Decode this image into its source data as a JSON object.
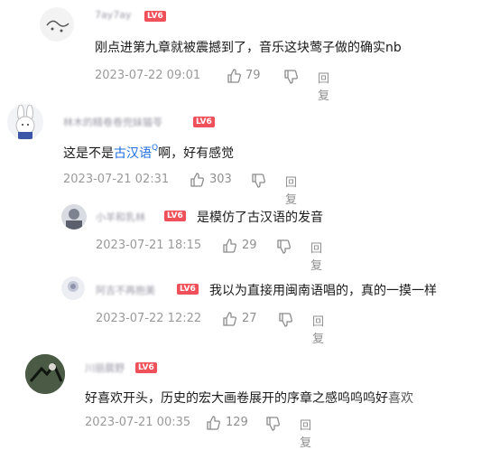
{
  "comments": [
    {
      "username": "7ay7ay",
      "level": "LV6",
      "text": "刚点进第九章就被震撼到了，音乐这块莺子做的确实nb",
      "date": "2023-07-22 09:01",
      "likes": "79",
      "reply_label": "回复"
    },
    {
      "username": "林木的精卷卷兜妹猫苓",
      "level": "LV6",
      "text_before": "这是不是",
      "link_text": "古汉语",
      "link_mark": "Q",
      "text_after": "啊，好有感觉",
      "date": "2023-07-21 02:31",
      "likes": "303",
      "reply_label": "回复"
    },
    {
      "username": "小羊和乳林",
      "level": "LV6",
      "text": "是模仿了古汉语的发音",
      "date": "2023-07-21 18:15",
      "likes": "29",
      "reply_label": "回复"
    },
    {
      "username": "阿吉不再抱美",
      "level": "LV6",
      "text": "我以为直接用闽南语唱的，真的一摸一样",
      "date": "2023-07-22 12:22",
      "likes": "27",
      "reply_label": "回复"
    },
    {
      "username": "川丽晨野",
      "level": "LV6",
      "text": "好喜欢开头，历史的宏大画卷展开的序章之感呜呜呜好",
      "text_tail": "喜欢",
      "date": "2023-07-21 00:35",
      "likes": "129",
      "reply_label": "回复"
    }
  ]
}
